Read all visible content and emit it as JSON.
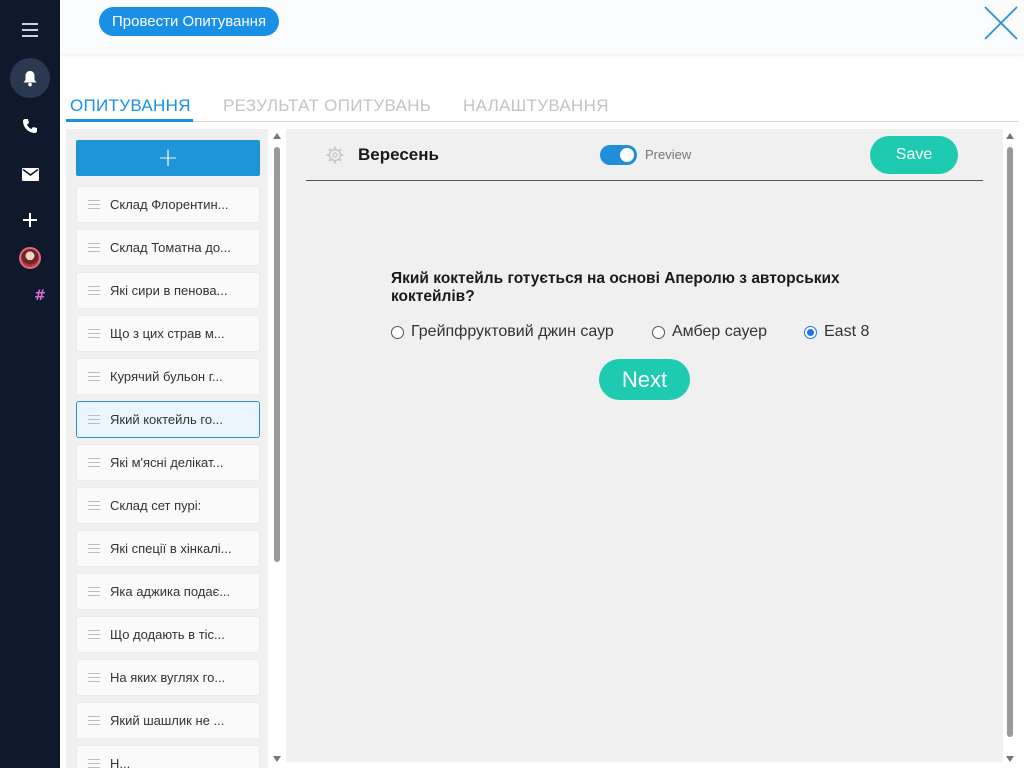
{
  "header": {
    "run_survey_label": "Провести Опитування"
  },
  "tabs": [
    {
      "label": "ОПИТУВАННЯ",
      "active": true
    },
    {
      "label": "РЕЗУЛЬТАТ ОПИТУВАНЬ",
      "active": false
    },
    {
      "label": "НАЛАШТУВАННЯ",
      "active": false
    }
  ],
  "sidebar": {
    "add_button_label": "+",
    "hash_label": "#",
    "items": [
      {
        "label": "Склад Флорентин..."
      },
      {
        "label": "Склад Томатна до..."
      },
      {
        "label": "Які сири в пенова..."
      },
      {
        "label": "Що з цих страв м..."
      },
      {
        "label": "Курячий бульон г..."
      },
      {
        "label": "Який коктейль го...",
        "selected": true
      },
      {
        "label": "Які м'ясні делікат..."
      },
      {
        "label": "Склад сет пурі:"
      },
      {
        "label": "Які спеції в хінкалі..."
      },
      {
        "label": "Яка аджика подає..."
      },
      {
        "label": "Що додають в тіс..."
      },
      {
        "label": "На яких вуглях го..."
      },
      {
        "label": "Який шашлик не ..."
      },
      {
        "label": "Н..."
      }
    ]
  },
  "editor": {
    "title": "Вересень",
    "preview_label": "Preview",
    "preview_enabled": true,
    "save_label": "Save",
    "question": "Який коктейль готується на основі Аперолю з авторських коктейлів?",
    "options": [
      {
        "label": "Грейпфруктовий джин саур",
        "checked": false
      },
      {
        "label": "Амбер сауер",
        "checked": false
      },
      {
        "label": "East 8",
        "checked": true
      }
    ],
    "next_label": "Next"
  },
  "colors": {
    "accent": "#1a8fe6",
    "teal": "#1fcbb0",
    "rail": "#0e1a2c"
  }
}
